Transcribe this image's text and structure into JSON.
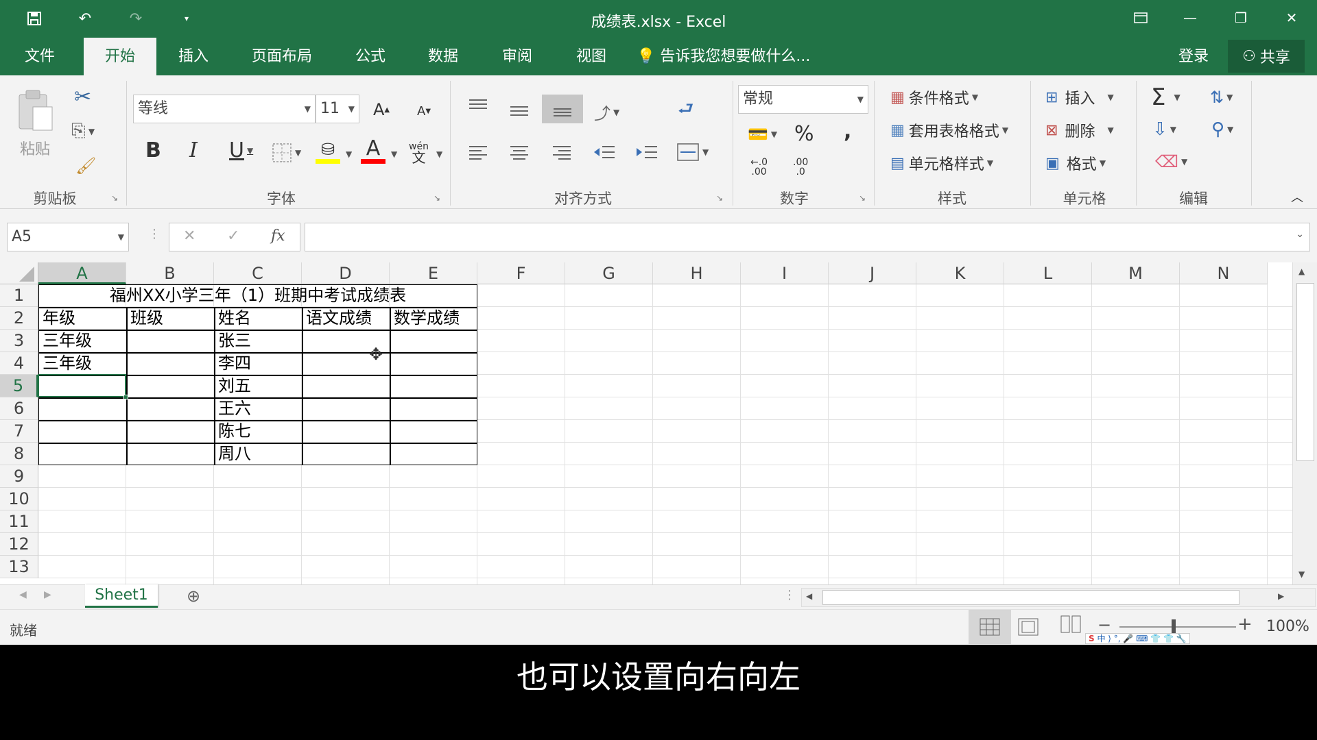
{
  "window": {
    "title": "成绩表.xlsx - Excel",
    "quick_access": [
      "save-icon",
      "undo-icon",
      "redo-icon",
      "customize-icon"
    ],
    "brand_color": "#217346"
  },
  "tabs": {
    "items": [
      "文件",
      "开始",
      "插入",
      "页面布局",
      "公式",
      "数据",
      "审阅",
      "视图"
    ],
    "active": "开始",
    "tell_me": "告诉我您想要做什么...",
    "login": "登录",
    "share": "共享"
  },
  "ribbon": {
    "clipboard": {
      "label": "剪贴板",
      "paste": "粘贴"
    },
    "font": {
      "label": "字体",
      "name": "等线",
      "size": "11",
      "bold": "B",
      "italic": "I",
      "underline": "U",
      "font_color_letter": "A",
      "phonetic": "wén",
      "phonetic_char": "文"
    },
    "alignment": {
      "label": "对齐方式"
    },
    "number": {
      "label": "数字",
      "format": "常规",
      "percent": "%",
      "comma": ",",
      "inc_decimal": ".00",
      "dec_decimal": ".0"
    },
    "styles": {
      "label": "样式",
      "conditional": "条件格式",
      "table": "套用表格格式",
      "cell": "单元格样式"
    },
    "cells": {
      "label": "单元格",
      "insert": "插入",
      "delete": "删除",
      "format": "格式"
    },
    "editing": {
      "label": "编辑",
      "sum": "Σ"
    }
  },
  "formula_bar": {
    "name_box": "A5",
    "cancel": "✕",
    "enter": "✓",
    "fx": "fx",
    "content": ""
  },
  "grid": {
    "columns": [
      "A",
      "B",
      "C",
      "D",
      "E",
      "F",
      "G",
      "H",
      "I",
      "J",
      "K",
      "L",
      "M",
      "N"
    ],
    "rows": [
      "1",
      "2",
      "3",
      "4",
      "5",
      "6",
      "7",
      "8",
      "9",
      "10",
      "11",
      "12",
      "13"
    ],
    "selected_cell": "A5",
    "title": "福州XX小学三年（1）班期中考试成绩表",
    "headers": [
      "年级",
      "班级",
      "姓名",
      "语文成绩",
      "数学成绩"
    ],
    "data_rows": [
      [
        "三年级",
        "",
        "张三",
        "",
        ""
      ],
      [
        "三年级",
        "",
        "李四",
        "",
        ""
      ],
      [
        "",
        "",
        "刘五",
        "",
        ""
      ],
      [
        "",
        "",
        "王六",
        "",
        ""
      ],
      [
        "",
        "",
        "陈七",
        "",
        ""
      ],
      [
        "",
        "",
        "周八",
        "",
        ""
      ]
    ]
  },
  "sheets": {
    "tabs": [
      "Sheet1"
    ],
    "active": "Sheet1"
  },
  "status": {
    "ready": "就绪",
    "zoom": "100%",
    "zoom_minus": "−",
    "zoom_plus": "+"
  },
  "subtitle": "也可以设置向右向左"
}
